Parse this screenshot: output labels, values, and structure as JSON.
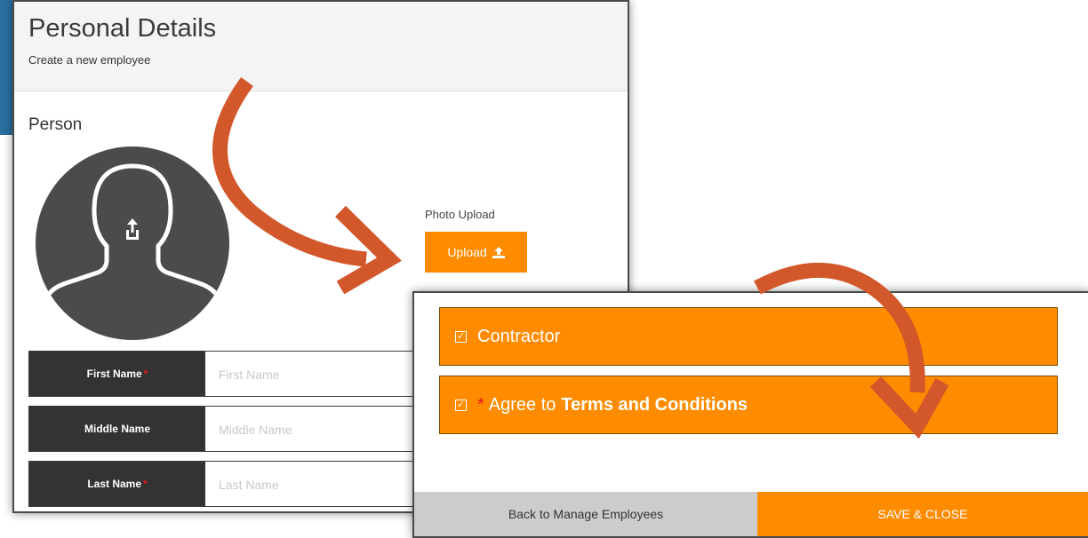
{
  "header": {
    "title": "Personal Details",
    "subtitle": "Create a new employee"
  },
  "person": {
    "section_title": "Person",
    "photo_label": "Photo Upload",
    "upload_label": "Upload"
  },
  "fields": [
    {
      "label": "First Name",
      "required": "*",
      "placeholder": "First Name"
    },
    {
      "label": "Middle Name",
      "required": "",
      "placeholder": "Middle Name"
    },
    {
      "label": "Last Name",
      "required": "*",
      "placeholder": "Last Name"
    }
  ],
  "checkboxes": {
    "contractor": {
      "label": "Contractor",
      "checked": "☑"
    },
    "terms": {
      "required": "*",
      "label_prefix": "Agree to",
      "label_bold": "Terms and Conditions",
      "checked": "☑"
    }
  },
  "footer": {
    "back_label": "Back to Manage Employees",
    "save_label": "SAVE & CLOSE"
  },
  "colors": {
    "accent": "#ff8c00",
    "arrow": "#d2572a",
    "label_bg": "#333333",
    "avatar_bg": "#4b4b4b",
    "blue_strip": "#2a6fa1"
  },
  "icons": {
    "upload": "upload-icon",
    "avatar": "avatar-icon",
    "checkbox": "checkbox-checked-icon",
    "arrow": "curved-arrow-icon"
  }
}
